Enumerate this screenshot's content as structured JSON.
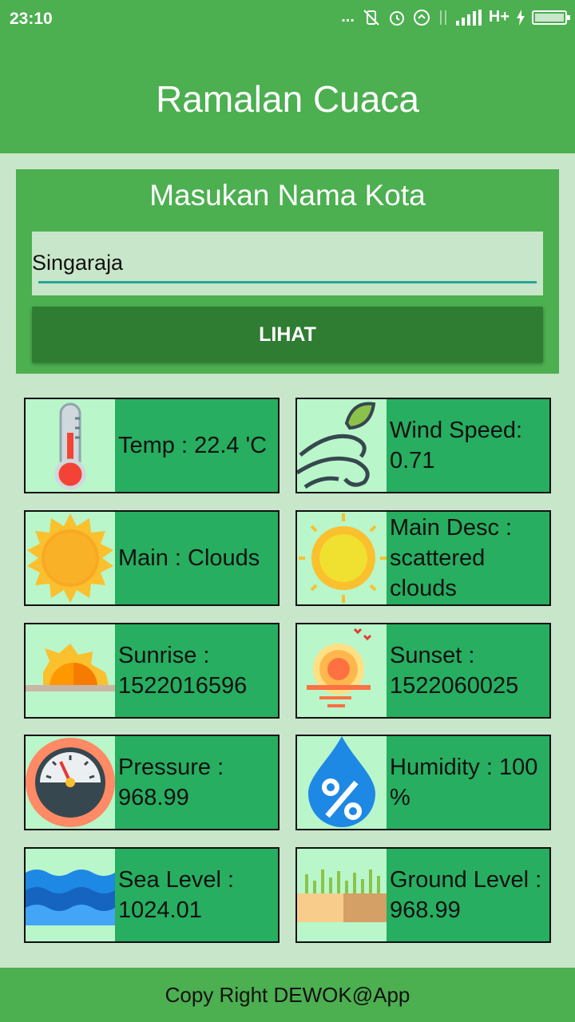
{
  "status_bar": {
    "time": "23:10",
    "network": "H+",
    "more": "..."
  },
  "app_bar": {
    "title": "Ramalan Cuaca"
  },
  "search": {
    "label": "Masukan Nama Kota",
    "input_value": "Singaraja",
    "button_label": "LIHAT"
  },
  "tiles": [
    {
      "icon": "thermometer-icon",
      "text": "Temp : 22.4 'C"
    },
    {
      "icon": "wind-leaf-icon",
      "text": "Wind Speed: 0.71"
    },
    {
      "icon": "sun-icon",
      "text": "Main : Clouds"
    },
    {
      "icon": "sun-rays-icon",
      "text": "Main Desc : scattered clouds"
    },
    {
      "icon": "sunrise-icon",
      "text": "Sunrise : 1522016596"
    },
    {
      "icon": "sunset-icon",
      "text": "Sunset : 1522060025"
    },
    {
      "icon": "pressure-gauge-icon",
      "text": "Pressure : 968.99"
    },
    {
      "icon": "humidity-drop-icon",
      "text": "Humidity : 100 %"
    },
    {
      "icon": "sea-waves-icon",
      "text": "Sea Level : 1024.01"
    },
    {
      "icon": "ground-grass-icon",
      "text": "Ground Level : 968.99"
    }
  ],
  "footer": {
    "text": "Copy Right DEWOK@App"
  },
  "colors": {
    "primary": "#4caf50",
    "primary_dark": "#2e7d32",
    "tile": "#27ae60",
    "background": "#c8e6c9",
    "accent": "#26a69a"
  }
}
